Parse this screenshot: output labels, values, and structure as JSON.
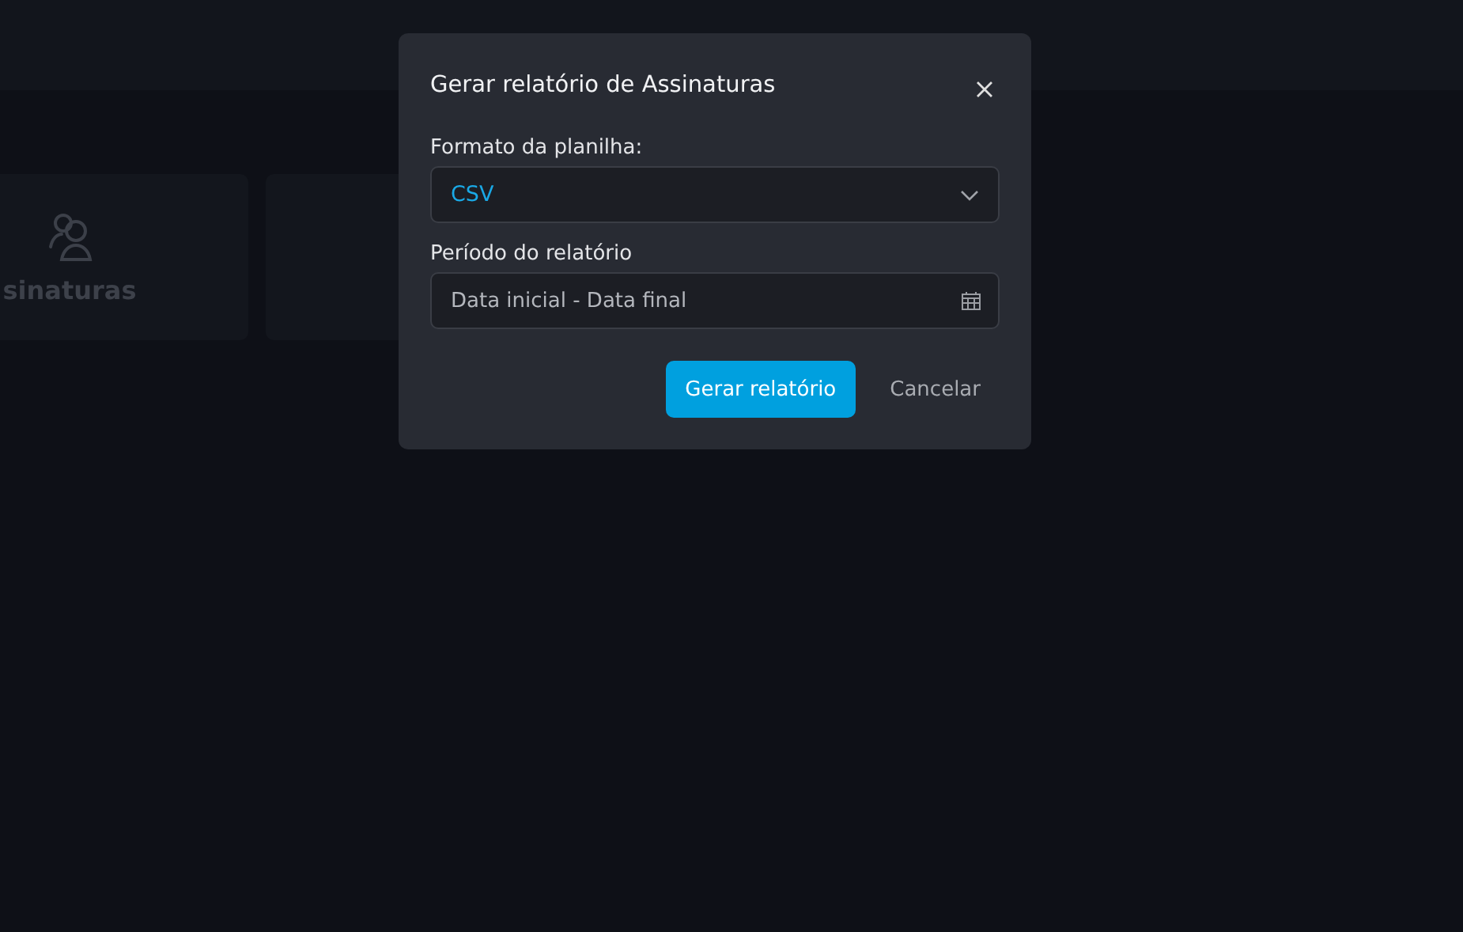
{
  "background": {
    "cards": [
      {
        "kind": "users",
        "label": "sinaturas"
      },
      {
        "kind": "blank"
      }
    ]
  },
  "dialog": {
    "title": "Gerar relatório de Assinaturas",
    "fields": [
      {
        "kind": "select",
        "label": "Formato da planilha:",
        "value": "CSV"
      },
      {
        "kind": "daterange",
        "label": "Período do relatório",
        "placeholder": "Data inicial - Data final"
      }
    ],
    "buttons": [
      {
        "kind": "primary",
        "label": "Gerar relatório"
      },
      {
        "kind": "plain",
        "label": "Cancelar"
      }
    ]
  }
}
